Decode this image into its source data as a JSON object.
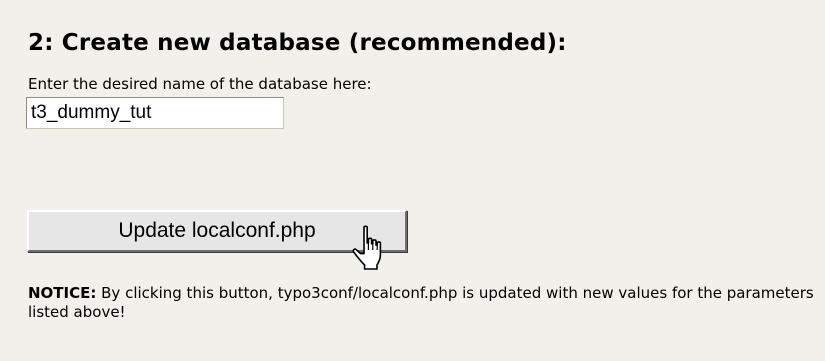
{
  "section": {
    "heading": "2: Create new database (recommended):",
    "field_label": "Enter the desired name of the database here:",
    "database_name_value": "t3_dummy_tut"
  },
  "actions": {
    "update_label": "Update localconf.php"
  },
  "cursor": {
    "icon": "hand-pointer-icon"
  },
  "notice": {
    "label": "NOTICE:",
    "text": " By clicking this button, typo3conf/localconf.php is updated with new values for the parameters listed above!"
  },
  "colors": {
    "background": "#f2f0ea",
    "button_face": "#e6e6e6"
  }
}
